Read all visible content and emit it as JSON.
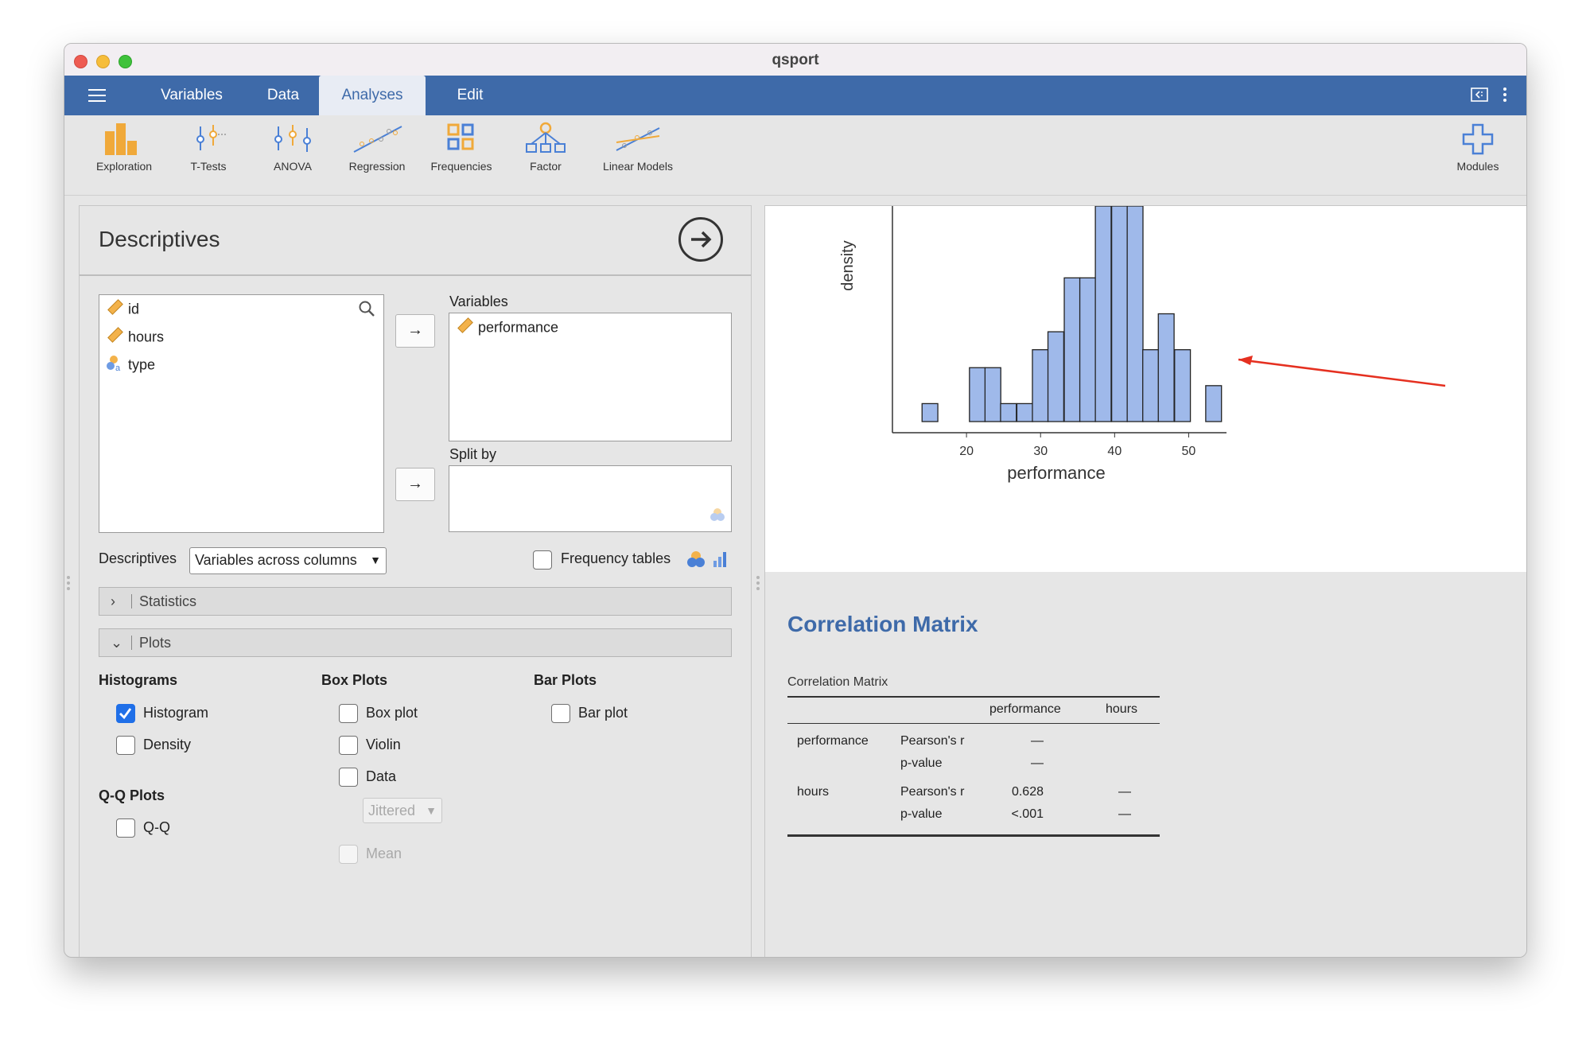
{
  "window": {
    "title": "qsport"
  },
  "menubar": {
    "tabs": [
      {
        "label": "Variables",
        "active": false
      },
      {
        "label": "Data",
        "active": false
      },
      {
        "label": "Analyses",
        "active": true
      },
      {
        "label": "Edit",
        "active": false
      }
    ]
  },
  "ribbon": {
    "buttons": [
      {
        "label": "Exploration",
        "icon": "exploration-icon"
      },
      {
        "label": "T-Tests",
        "icon": "t-tests-icon"
      },
      {
        "label": "ANOVA",
        "icon": "anova-icon"
      },
      {
        "label": "Regression",
        "icon": "regression-icon"
      },
      {
        "label": "Frequencies",
        "icon": "frequencies-icon"
      },
      {
        "label": "Factor",
        "icon": "factor-icon"
      },
      {
        "label": "Linear Models",
        "icon": "linear-models-icon"
      }
    ],
    "modules_label": "Modules"
  },
  "panel": {
    "title": "Descriptives",
    "source_variables": [
      {
        "name": "id",
        "type": "continuous"
      },
      {
        "name": "hours",
        "type": "continuous"
      },
      {
        "name": "type",
        "type": "nominal"
      }
    ],
    "variables_label": "Variables",
    "variables_assigned": [
      {
        "name": "performance",
        "type": "continuous"
      }
    ],
    "split_by_label": "Split by",
    "descriptives_label": "Descriptives",
    "descriptives_select": "Variables across columns",
    "frequency_tables_label": "Frequency tables",
    "frequency_tables_checked": false,
    "sections": {
      "statistics": "Statistics",
      "plots": "Plots"
    },
    "plots": {
      "histograms_heading": "Histograms",
      "histogram_label": "Histogram",
      "histogram_checked": true,
      "density_label": "Density",
      "density_checked": false,
      "qq_heading": "Q-Q Plots",
      "qq_label": "Q-Q",
      "qq_checked": false,
      "boxplots_heading": "Box Plots",
      "boxplot_label": "Box plot",
      "boxplot_checked": false,
      "violin_label": "Violin",
      "violin_checked": false,
      "data_label": "Data",
      "data_checked": false,
      "jittered_select": "Jittered",
      "mean_label": "Mean",
      "mean_checked": false,
      "barplots_heading": "Bar Plots",
      "barplot_label": "Bar plot",
      "barplot_checked": false
    }
  },
  "chart_data": {
    "type": "bar",
    "xlabel": "performance",
    "ylabel": "density",
    "title": "",
    "xlim": [
      10,
      55
    ],
    "xticks": [
      20,
      30,
      40,
      50
    ],
    "bin_width": 2.13,
    "bins": [
      {
        "x0": 14.0,
        "h": 1
      },
      {
        "x0": 20.4,
        "h": 3
      },
      {
        "x0": 22.5,
        "h": 3
      },
      {
        "x0": 24.6,
        "h": 1
      },
      {
        "x0": 26.8,
        "h": 1
      },
      {
        "x0": 28.9,
        "h": 4
      },
      {
        "x0": 31.0,
        "h": 5
      },
      {
        "x0": 33.2,
        "h": 8
      },
      {
        "x0": 35.3,
        "h": 8
      },
      {
        "x0": 37.4,
        "h": 12
      },
      {
        "x0": 39.6,
        "h": 12
      },
      {
        "x0": 41.7,
        "h": 12
      },
      {
        "x0": 43.8,
        "h": 4
      },
      {
        "x0": 45.9,
        "h": 6
      },
      {
        "x0": 48.1,
        "h": 4
      },
      {
        "x0": 52.3,
        "h": 2
      }
    ],
    "bar_color": "#9fb9ea",
    "edge_color": "#222222",
    "annotation_arrow_color": "#e53020"
  },
  "correlation": {
    "heading": "Correlation Matrix",
    "caption": "Correlation Matrix",
    "columns": [
      "performance",
      "hours"
    ],
    "rows": [
      {
        "var": "performance",
        "stats": [
          [
            "Pearson's r",
            "—",
            ""
          ],
          [
            "p-value",
            "—",
            ""
          ]
        ]
      },
      {
        "var": "hours",
        "stats": [
          [
            "Pearson's r",
            "0.628",
            "—"
          ],
          [
            "p-value",
            "<.001",
            "—"
          ]
        ]
      }
    ]
  }
}
